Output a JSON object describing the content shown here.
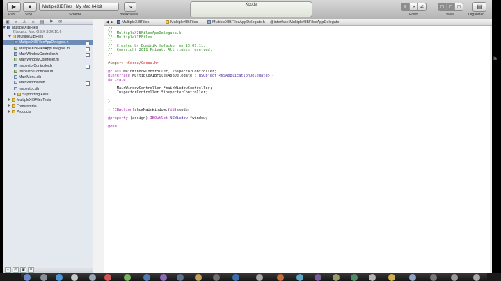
{
  "toolbar": {
    "run_label": "Run",
    "stop_label": "Stop",
    "scheme_value": "MultipleXIBFiles | My Mac 64-bit",
    "scheme_label": "Scheme",
    "breakpoints_label": "Breakpoints",
    "activity_title": "Xcode",
    "editor_label": "Editor",
    "view_label": "View",
    "organizer_label": "Organizer"
  },
  "navigator": {
    "project_name": "MultipleXIBFiles",
    "project_sub": "2 targets, Mac OS X SDK 10.6",
    "items": [
      {
        "label": "MultipleXIBFiles",
        "kind": "folder",
        "indent": 1,
        "open": true
      },
      {
        "label": "MultipleXIBFilesAppDelegate.h",
        "kind": "h",
        "indent": 2,
        "selected": true
      },
      {
        "label": "MultipleXIBFilesAppDelegate.m",
        "kind": "m",
        "indent": 2
      },
      {
        "label": "MainWindowController.h",
        "kind": "h",
        "indent": 2
      },
      {
        "label": "MainWindowController.m",
        "kind": "m",
        "indent": 2
      },
      {
        "label": "InspectorController.h",
        "kind": "h",
        "indent": 2
      },
      {
        "label": "InspectorController.m",
        "kind": "m",
        "indent": 2
      },
      {
        "label": "MainMenu.xib",
        "kind": "xib",
        "indent": 2
      },
      {
        "label": "MainWindow.xib",
        "kind": "xib",
        "indent": 2
      },
      {
        "label": "Inspector.xib",
        "kind": "xib",
        "indent": 2
      },
      {
        "label": "Supporting Files",
        "kind": "folder",
        "indent": 2,
        "open": false
      },
      {
        "label": "MultipleXIBFilesTests",
        "kind": "folder",
        "indent": 1,
        "open": false
      },
      {
        "label": "Frameworks",
        "kind": "folder",
        "indent": 1,
        "open": false
      },
      {
        "label": "Products",
        "kind": "folder",
        "indent": 1,
        "open": false
      }
    ]
  },
  "jumpbar": {
    "crumbs": [
      "MultipleXIBFiles",
      "MultipleXIBFiles",
      "MultipleXIBFilesAppDelegate.h",
      "@interface MultipleXIBFilesAppDelegate"
    ]
  },
  "code": {
    "lines": [
      [
        {
          "t": "//",
          "c": "comment"
        }
      ],
      [
        {
          "t": "//  MultipleXIBFilesAppDelegate.h",
          "c": "comment"
        }
      ],
      [
        {
          "t": "//  MultipleXIBFiles",
          "c": "comment"
        }
      ],
      [
        {
          "t": "//",
          "c": "comment"
        }
      ],
      [
        {
          "t": "//  Created by Dominik Hofacker on 15.07.11.",
          "c": "comment"
        }
      ],
      [
        {
          "t": "//  Copyright 2011 Privat. All rights reserved.",
          "c": "comment"
        }
      ],
      [
        {
          "t": "//",
          "c": "comment"
        }
      ],
      [],
      [
        {
          "t": "#import ",
          "c": "pre"
        },
        {
          "t": "<Cocoa/Cocoa.h>",
          "c": "str"
        }
      ],
      [],
      [
        {
          "t": "@class ",
          "c": "kw"
        },
        {
          "t": "MainWindowController, InspectorController;",
          "c": "plain"
        }
      ],
      [
        {
          "t": "@interface ",
          "c": "kw"
        },
        {
          "t": "MultipleXIBFilesAppDelegate : ",
          "c": "plain"
        },
        {
          "t": "NSObject ",
          "c": "cls"
        },
        {
          "t": "<NSApplicationDelegate> {",
          "c": "cls"
        }
      ],
      [
        {
          "t": "@private",
          "c": "kw"
        }
      ],
      [],
      [
        {
          "t": "    MainWindowController *mainWindowController;",
          "c": "plain"
        }
      ],
      [
        {
          "t": "    InspectorController *inspectorController;",
          "c": "plain"
        }
      ],
      [],
      [
        {
          "t": "}",
          "c": "plain"
        }
      ],
      [],
      [
        {
          "t": "- (",
          "c": "plain"
        },
        {
          "t": "IBAction",
          "c": "kw"
        },
        {
          "t": ")showMainWindow:(",
          "c": "plain"
        },
        {
          "t": "id",
          "c": "kw"
        },
        {
          "t": ")sender;",
          "c": "plain"
        }
      ],
      [],
      [
        {
          "t": "@property ",
          "c": "kw"
        },
        {
          "t": "(assign) ",
          "c": "plain"
        },
        {
          "t": "IBOutlet ",
          "c": "kw"
        },
        {
          "t": "NSWindow ",
          "c": "cls"
        },
        {
          "t": "*window;",
          "c": "plain"
        }
      ],
      [],
      [
        {
          "t": "@end",
          "c": "kw"
        }
      ]
    ]
  },
  "desktop_text": "ile"
}
